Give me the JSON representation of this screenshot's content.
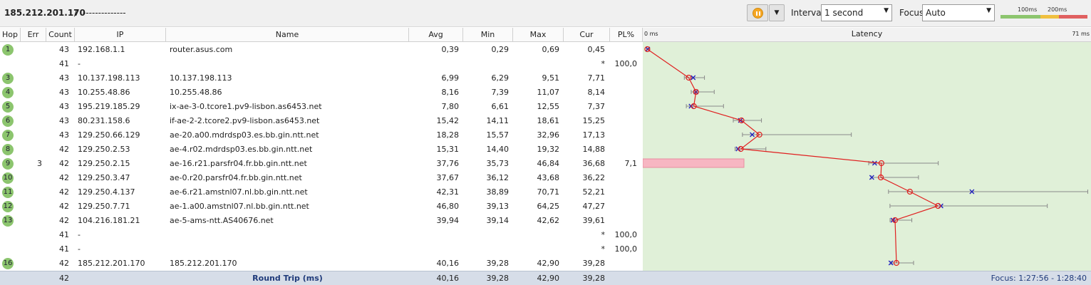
{
  "toolbar": {
    "host": "185.212.201.170",
    "separator": "/",
    "name": "--------------",
    "interval_label": "Interval",
    "interval_value": "1 second",
    "focus_label": "Focus",
    "focus_value": "Auto",
    "scale_100": "100ms",
    "scale_200": "200ms",
    "pause_icon": "pause-icon",
    "colors": {
      "pause": "#f5a623",
      "good": "#8cc56e",
      "warn": "#f0c040",
      "bad": "#e06060"
    }
  },
  "columns": {
    "hop": "Hop",
    "err": "Err",
    "count": "Count",
    "ip": "IP",
    "name": "Name",
    "avg": "Avg",
    "min": "Min",
    "max": "Max",
    "cur": "Cur",
    "pl": "PL%"
  },
  "latency": {
    "title": "Latency",
    "min_label": "0 ms",
    "max_label": "71 ms",
    "max_ms": 71
  },
  "rows": [
    {
      "hop": "1",
      "err": "",
      "count": "43",
      "ip": "192.168.1.1",
      "name": "router.asus.com",
      "avg": "0,39",
      "min": "0,29",
      "max": "0,69",
      "cur": "0,45",
      "pl": ""
    },
    {
      "hop": "",
      "err": "",
      "count": "41",
      "ip": "-",
      "name": "",
      "avg": "",
      "min": "",
      "max": "",
      "cur": "*",
      "pl": "100,0"
    },
    {
      "hop": "3",
      "err": "",
      "count": "43",
      "ip": "10.137.198.113",
      "name": "10.137.198.113",
      "avg": "6,99",
      "min": "6,29",
      "max": "9,51",
      "cur": "7,71",
      "pl": ""
    },
    {
      "hop": "4",
      "err": "",
      "count": "43",
      "ip": "10.255.48.86",
      "name": "10.255.48.86",
      "avg": "8,16",
      "min": "7,39",
      "max": "11,07",
      "cur": "8,14",
      "pl": ""
    },
    {
      "hop": "5",
      "err": "",
      "count": "43",
      "ip": "195.219.185.29",
      "name": "ix-ae-3-0.tcore1.pv9-lisbon.as6453.net",
      "avg": "7,80",
      "min": "6,61",
      "max": "12,55",
      "cur": "7,37",
      "pl": ""
    },
    {
      "hop": "6",
      "err": "",
      "count": "43",
      "ip": "80.231.158.6",
      "name": "if-ae-2-2.tcore2.pv9-lisbon.as6453.net",
      "avg": "15,42",
      "min": "14,11",
      "max": "18,61",
      "cur": "15,25",
      "pl": ""
    },
    {
      "hop": "7",
      "err": "",
      "count": "43",
      "ip": "129.250.66.129",
      "name": "ae-20.a00.mdrdsp03.es.bb.gin.ntt.net",
      "avg": "18,28",
      "min": "15,57",
      "max": "32,96",
      "cur": "17,13",
      "pl": ""
    },
    {
      "hop": "8",
      "err": "",
      "count": "42",
      "ip": "129.250.2.53",
      "name": "ae-4.r02.mdrdsp03.es.bb.gin.ntt.net",
      "avg": "15,31",
      "min": "14,40",
      "max": "19,32",
      "cur": "14,88",
      "pl": ""
    },
    {
      "hop": "9",
      "err": "3",
      "count": "42",
      "ip": "129.250.2.15",
      "name": "ae-16.r21.parsfr04.fr.bb.gin.ntt.net",
      "avg": "37,76",
      "min": "35,73",
      "max": "46,84",
      "cur": "36,68",
      "pl": "7,1"
    },
    {
      "hop": "10",
      "err": "",
      "count": "42",
      "ip": "129.250.3.47",
      "name": "ae-0.r20.parsfr04.fr.bb.gin.ntt.net",
      "avg": "37,67",
      "min": "36,12",
      "max": "43,68",
      "cur": "36,22",
      "pl": ""
    },
    {
      "hop": "11",
      "err": "",
      "count": "42",
      "ip": "129.250.4.137",
      "name": "ae-6.r21.amstnl07.nl.bb.gin.ntt.net",
      "avg": "42,31",
      "min": "38,89",
      "max": "70,71",
      "cur": "52,21",
      "pl": ""
    },
    {
      "hop": "12",
      "err": "",
      "count": "42",
      "ip": "129.250.7.71",
      "name": "ae-1.a00.amstnl07.nl.bb.gin.ntt.net",
      "avg": "46,80",
      "min": "39,13",
      "max": "64,25",
      "cur": "47,27",
      "pl": ""
    },
    {
      "hop": "13",
      "err": "",
      "count": "42",
      "ip": "104.216.181.21",
      "name": "ae-5-ams-ntt.AS40676.net",
      "avg": "39,94",
      "min": "39,14",
      "max": "42,62",
      "cur": "39,61",
      "pl": ""
    },
    {
      "hop": "",
      "err": "",
      "count": "41",
      "ip": "-",
      "name": "",
      "avg": "",
      "min": "",
      "max": "",
      "cur": "*",
      "pl": "100,0"
    },
    {
      "hop": "",
      "err": "",
      "count": "41",
      "ip": "-",
      "name": "",
      "avg": "",
      "min": "",
      "max": "",
      "cur": "*",
      "pl": "100,0"
    },
    {
      "hop": "16",
      "err": "",
      "count": "42",
      "ip": "185.212.201.170",
      "name": "185.212.201.170",
      "avg": "40,16",
      "min": "39,28",
      "max": "42,90",
      "cur": "39,28",
      "pl": ""
    }
  ],
  "footer": {
    "count": "42",
    "label": "Round Trip (ms)",
    "avg": "40,16",
    "min": "39,28",
    "max": "42,90",
    "cur": "39,28",
    "focus": "Focus: 1:27:56 - 1:28:40"
  }
}
